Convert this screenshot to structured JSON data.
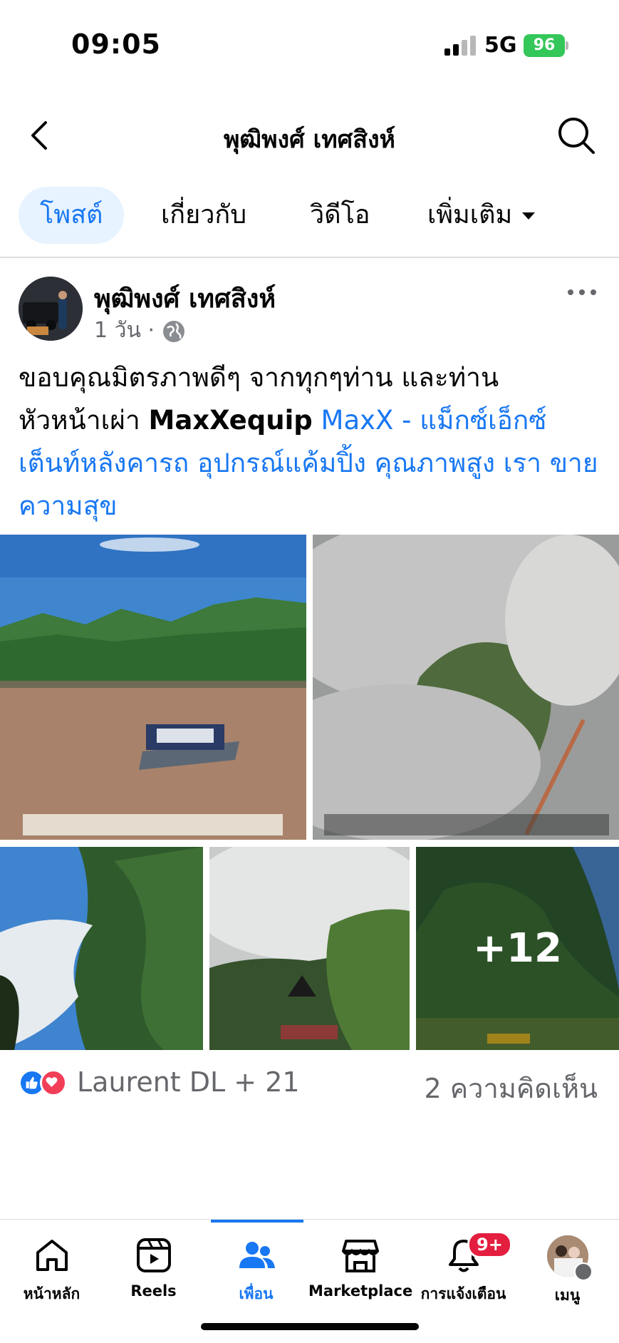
{
  "status_bar": {
    "time": "09:05",
    "network": "5G",
    "battery": "96"
  },
  "header": {
    "title": "พุฒิพงศ์ เทศสิงห์",
    "back_icon": "chevron-left-icon",
    "search_icon": "search-icon"
  },
  "tabs": [
    {
      "label": "โพสต์",
      "active": true
    },
    {
      "label": "เกี่ยวกับ",
      "active": false
    },
    {
      "label": "วิดีโอ",
      "active": false
    },
    {
      "label": "เพิ่มเติม",
      "active": false
    }
  ],
  "post": {
    "author": "พุฒิพงศ์ เทศสิงห์",
    "time": "1 วัน",
    "text_line1": "ขอบคุณมิตรภาพดีๆ จากทุกๆท่าน และท่าน",
    "text_line2_plain": "หัวหน้าเผ่า ",
    "text_bold": "MaxXequip",
    "text_link": "MaxX - แม็กซ์เอ็กซ์ เต็นท์หลังคารถ อุปกรณ์แค้มปิ้ง คุณภาพสูง เรา ขายความสุข",
    "more_photos": "+12",
    "reactions_text": "Laurent DL + 21",
    "comments_text": "2 ความคิดเห็น"
  },
  "bottom_nav": [
    {
      "label": "หน้าหลัก",
      "icon": "home-icon"
    },
    {
      "label": "Reels",
      "icon": "reels-icon"
    },
    {
      "label": "เพื่อน",
      "icon": "friends-icon",
      "active": true
    },
    {
      "label": "Marketplace",
      "icon": "marketplace-icon"
    },
    {
      "label": "การแจ้งเตือน",
      "icon": "bell-icon",
      "badge": "9+"
    },
    {
      "label": "เมนู",
      "icon": "menu-avatar-icon"
    }
  ],
  "colors": {
    "accent": "#1877f2",
    "muted": "#65676b",
    "tab_active_bg": "#e7f3ff",
    "badge": "#e41e3f"
  }
}
